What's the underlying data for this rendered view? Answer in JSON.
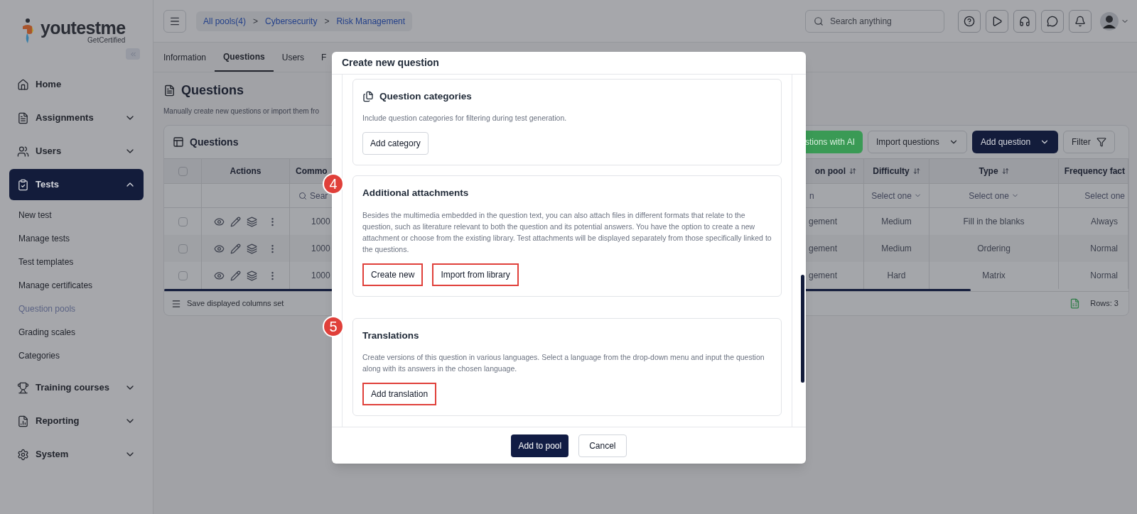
{
  "sidebar": {
    "logo": {
      "name": "youtestme",
      "tagline": "GetCertified"
    },
    "items": [
      {
        "label": "Home",
        "kind": "link",
        "selected": false
      },
      {
        "label": "Assignments",
        "kind": "group",
        "selected": false,
        "expanded": false
      },
      {
        "label": "Users",
        "kind": "group",
        "selected": false,
        "expanded": false
      },
      {
        "label": "Tests",
        "kind": "group",
        "selected": true,
        "expanded": true,
        "children": [
          {
            "label": "New test",
            "selected": false
          },
          {
            "label": "Manage tests",
            "selected": false
          },
          {
            "label": "Test templates",
            "selected": false
          },
          {
            "label": "Manage certificates",
            "selected": false
          },
          {
            "label": "Question pools",
            "selected": true
          },
          {
            "label": "Grading scales",
            "selected": false
          },
          {
            "label": "Categories",
            "selected": false
          }
        ]
      },
      {
        "label": "Training courses",
        "kind": "group",
        "selected": false,
        "expanded": false
      },
      {
        "label": "Reporting",
        "kind": "group",
        "selected": false,
        "expanded": false
      },
      {
        "label": "System",
        "kind": "group",
        "selected": false,
        "expanded": false
      }
    ]
  },
  "breadcrumbs": {
    "items": [
      "All pools(4)",
      "Cybersecurity",
      "Risk Management"
    ],
    "separators": [
      ">",
      ">"
    ]
  },
  "search": {
    "placeholder": "Search anything"
  },
  "tabs": [
    {
      "label": "Information",
      "selected": false
    },
    {
      "label": "Questions",
      "selected": true
    },
    {
      "label": "Users",
      "selected": false
    },
    {
      "label": "F",
      "selected": false
    }
  ],
  "page": {
    "title": "Questions",
    "description": "Manually create new questions or import them fro"
  },
  "table": {
    "title": "Questions",
    "toolbar": [
      {
        "label": "stions with AI",
        "kind": "ai"
      },
      {
        "label": "Import questions",
        "kind": "dropdown"
      },
      {
        "label": "Add question",
        "kind": "primary"
      },
      {
        "label": "Filter",
        "kind": "filter"
      }
    ],
    "select_all": {
      "checked": false
    },
    "columns": [
      {
        "label": "Actions",
        "sortable": false
      },
      {
        "label": "Commo",
        "sortable": false
      },
      {
        "label": "on pool",
        "sortable": true
      },
      {
        "label": "Difficulty",
        "sortable": true
      },
      {
        "label": "Type",
        "sortable": true
      },
      {
        "label": "Frequency fact",
        "sortable": false
      }
    ],
    "filters": [
      {
        "kind": "none"
      },
      {
        "kind": "none"
      },
      {
        "kind": "search",
        "placeholder": "Sear"
      },
      {
        "kind": "text",
        "value": "n"
      },
      {
        "kind": "select",
        "placeholder": "Select one"
      },
      {
        "kind": "select",
        "placeholder": "Select one"
      },
      {
        "kind": "cut",
        "placeholder": "Select one"
      }
    ],
    "rows": [
      {
        "checked": false,
        "column_3": "1000",
        "pool": "gement",
        "difficulty": "Medium",
        "type": "Fill in the blanks",
        "frequency": "Always"
      },
      {
        "checked": false,
        "column_3": "1000",
        "pool": "gement",
        "difficulty": "Medium",
        "type": "Ordering",
        "frequency": "Normal"
      },
      {
        "checked": false,
        "column_3": "1000",
        "pool": "gement",
        "difficulty": "Hard",
        "type": "Matrix",
        "frequency": "Normal"
      }
    ],
    "footer": {
      "save": "Save displayed columns set",
      "rows": "Rows: 3"
    }
  },
  "modal": {
    "title": "Create new question",
    "sections": [
      {
        "kind": "categories",
        "title": "Question categories",
        "description": "Include question categories for filtering during test generation.",
        "buttons": [
          {
            "label": "Add category",
            "highlighted": false
          }
        ]
      },
      {
        "kind": "plain",
        "marker": "4",
        "title": "Additional attachments",
        "description": "Besides the multimedia embedded in the question text, you can also attach files in different formats that relate to the question, such as literature relevant to both the question and its potential answers. You have the option to create a new attachment or choose from the existing library. Test attachments will be displayed separately from those specifically linked to the questions.",
        "buttons": [
          {
            "label": "Create new",
            "highlighted": true
          },
          {
            "label": "Import from library",
            "highlighted": true
          }
        ]
      },
      {
        "kind": "plain",
        "marker": "5",
        "title": "Translations",
        "description": "Create versions of this question in various languages. Select a language from the drop-down menu and input the question along with its answers in the chosen language.",
        "buttons": [
          {
            "label": "Add translation",
            "highlighted": true
          }
        ]
      }
    ],
    "footer": [
      {
        "label": "Add to pool",
        "kind": "primary"
      },
      {
        "label": "Cancel",
        "kind": "secondary"
      }
    ]
  }
}
